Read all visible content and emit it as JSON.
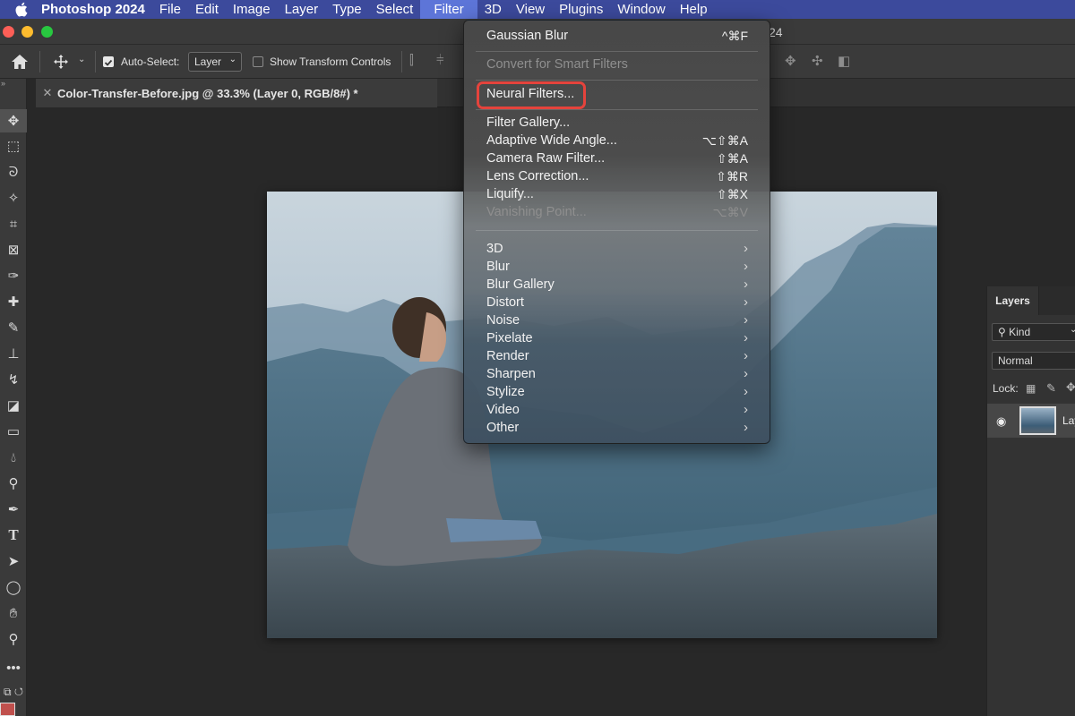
{
  "menubar": {
    "app_name": "Photoshop 2024",
    "items": [
      "File",
      "Edit",
      "Image",
      "Layer",
      "Type",
      "Select",
      "Filter",
      "3D",
      "View",
      "Plugins",
      "Window",
      "Help"
    ],
    "active_item": "Filter"
  },
  "window": {
    "title_tail": "24"
  },
  "options_bar": {
    "auto_select_label": "Auto-Select:",
    "auto_select_checked": true,
    "auto_select_target": "Layer",
    "show_transform_label": "Show Transform Controls",
    "show_transform_checked": false
  },
  "document": {
    "tab_title": "Color-Transfer-Before.jpg @ 33.3% (Layer 0, RGB/8#) *"
  },
  "filter_menu": {
    "last_filter": {
      "label": "Gaussian Blur",
      "shortcut": "^⌘F"
    },
    "convert_smart": "Convert for Smart Filters",
    "neural_filters": "Neural Filters...",
    "gallery_items": [
      {
        "label": "Filter Gallery...",
        "shortcut": ""
      },
      {
        "label": "Adaptive Wide Angle...",
        "shortcut": "⌥⇧⌘A"
      },
      {
        "label": "Camera Raw Filter...",
        "shortcut": "⇧⌘A"
      },
      {
        "label": "Lens Correction...",
        "shortcut": "⇧⌘R"
      },
      {
        "label": "Liquify...",
        "shortcut": "⇧⌘X"
      },
      {
        "label": "Vanishing Point...",
        "shortcut": "⌥⌘V",
        "disabled": true
      }
    ],
    "submenus": [
      "3D",
      "Blur",
      "Blur Gallery",
      "Distort",
      "Noise",
      "Pixelate",
      "Render",
      "Sharpen",
      "Stylize",
      "Video",
      "Other"
    ],
    "highlighted_item": "Neural Filters..."
  },
  "layers_panel": {
    "tab_label": "Layers",
    "filter_kind": "Kind",
    "blend_mode": "Normal",
    "lock_label": "Lock:",
    "layer_name_partial": "Lay"
  },
  "colors": {
    "menubar_bg": "#3c4a9c",
    "menubar_active": "#5d75d8",
    "highlight_ring": "#e5433c",
    "foreground_swatch": "#c0504d"
  }
}
